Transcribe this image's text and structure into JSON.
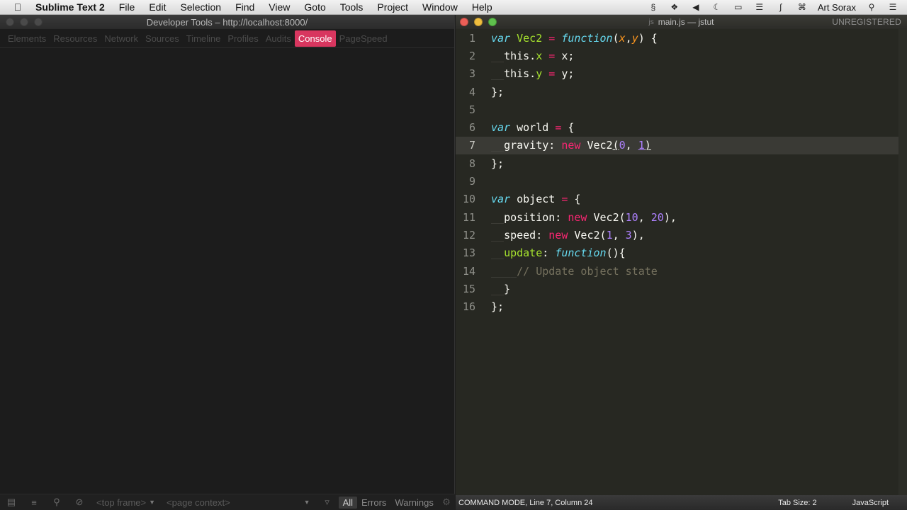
{
  "menubar": {
    "app_name": "Sublime Text 2",
    "items": [
      "File",
      "Edit",
      "Selection",
      "Find",
      "View",
      "Goto",
      "Tools",
      "Project",
      "Window",
      "Help"
    ],
    "user": "Art Sorax"
  },
  "devtools": {
    "title": "Developer Tools – http://localhost:8000/",
    "tabs": [
      "Elements",
      "Resources",
      "Network",
      "Sources",
      "Timeline",
      "Profiles",
      "Audits",
      "Console",
      "PageSpeed"
    ],
    "active_tab": "Console",
    "footer": {
      "frame_select": "<top frame>",
      "context_select": "<page context>",
      "all_label": "All",
      "errors_label": "Errors",
      "warnings_label": "Warnings"
    }
  },
  "sublime": {
    "title": "main.js — jstut",
    "file_icon": "js",
    "unregistered": "UNREGISTERED",
    "current_line": 7,
    "status": {
      "mode": "COMMAND MODE, Line 7, Column 24",
      "tab_size": "Tab Size: 2",
      "syntax": "JavaScript"
    },
    "code_lines": [
      "var Vec2 = function(x,y) {",
      "  this.x = x;",
      "  this.y = y;",
      "};",
      "",
      "var world = {",
      "  gravity: new Vec2(0, 1)",
      "};",
      "",
      "var object = {",
      "  position: new Vec2(10, 20),",
      "  speed: new Vec2(1, 3),",
      "  update: function(){",
      "    // Update object state",
      "  }",
      "};"
    ]
  }
}
